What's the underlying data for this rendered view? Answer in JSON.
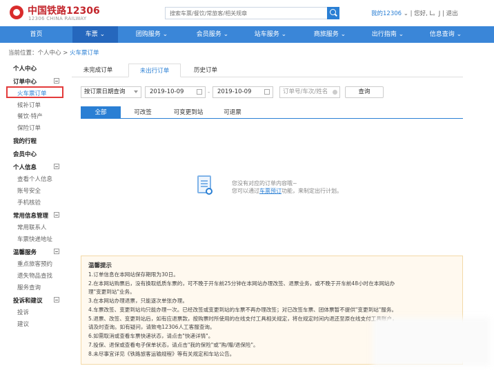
{
  "header": {
    "logo_name": "中国铁路12306",
    "logo_sub": "12306 CHINA RAILWAY",
    "search_placeholder": "搜索车票/餐饮/常旅客/相关规章",
    "my_link": "我的12306",
    "greeting": "您好, L。J",
    "logout": "退出"
  },
  "nav": {
    "items": [
      "首页",
      "车票",
      "团购服务",
      "会员服务",
      "站车服务",
      "商旅服务",
      "出行指南",
      "信息查询"
    ]
  },
  "breadcrumb": {
    "prefix": "当前位置：个人中心 > ",
    "current": "火车票订单"
  },
  "sidebar": {
    "personal_center": "个人中心",
    "order_center": "订单中心",
    "train_tickets": "火车票订单",
    "candidate_orders": "候补订单",
    "catering": "餐饮·特产",
    "insurance": "保险订单",
    "my_trips": "我的行程",
    "member_center": "会员中心",
    "personal_info": "个人信息",
    "view_info": "查看个人信息",
    "account_security": "账号安全",
    "phone_verify": "手机核验",
    "common_info": "常用信息管理",
    "contacts": "常用联系人",
    "delivery_address": "车票快递地址",
    "warm_service": "温馨服务",
    "key_passenger": "重点旅客预约",
    "lost_items": "遗失物品查找",
    "service_query": "服务查询",
    "complaints": "投诉和建议",
    "complaint": "投诉",
    "suggestion": "建议"
  },
  "tabs": [
    "未完成订单",
    "未出行订单",
    "历史订单"
  ],
  "filters": {
    "date_type": "按订票日期查询",
    "start_date": "2019-10-09",
    "end_date": "2019-10-09",
    "order_placeholder": "订单号/车次/姓名",
    "query_button": "查询"
  },
  "subtabs": [
    "全部",
    "可改签",
    "可变更到站",
    "可退票"
  ],
  "empty": {
    "line1": "您没有对应的订单内容哦~",
    "line2_prefix": "您可以通过",
    "line2_link": "车票预订",
    "line2_suffix": "功能，来制定出行计划。"
  },
  "tips": {
    "title": "温馨提示",
    "lines": [
      "1.订单信息在本网站保存期限为30日。",
      "2.在本网站购票后，没有换取纸质车票的，可不晚于开车前25分钟在本网站办理改签、退票业务，或不晚于开车前48小时在本网站办",
      "理\"变更到站\"业务。",
      "3.在本网站办理退票，只能逐次单张办理。",
      "4.车票改签、变更到站均只能办理一次。已经改签或变更到站的车票不再办理改签；对已改签车票、团体票暂不提供\"变更到站\"服务。",
      "5.退票、改签、变更到站后，如有应退票款，按购票时所使用的在线支付工具相关规定，将在规定时间内退还至原在线支付工具账户，",
      "请及时查询。如有疑问，请致电12306人工客服查询。",
      "6.如需取消或查看车票快递状态，请点击\"快递详情\"。",
      "7.投保、退保或查看电子保单状态，请点击\"我的保险\"或\"购/赠/退保险\"。",
      "8.未尽事宜详见《铁路旅客运输规程》等有关规定和车站公告。"
    ]
  }
}
